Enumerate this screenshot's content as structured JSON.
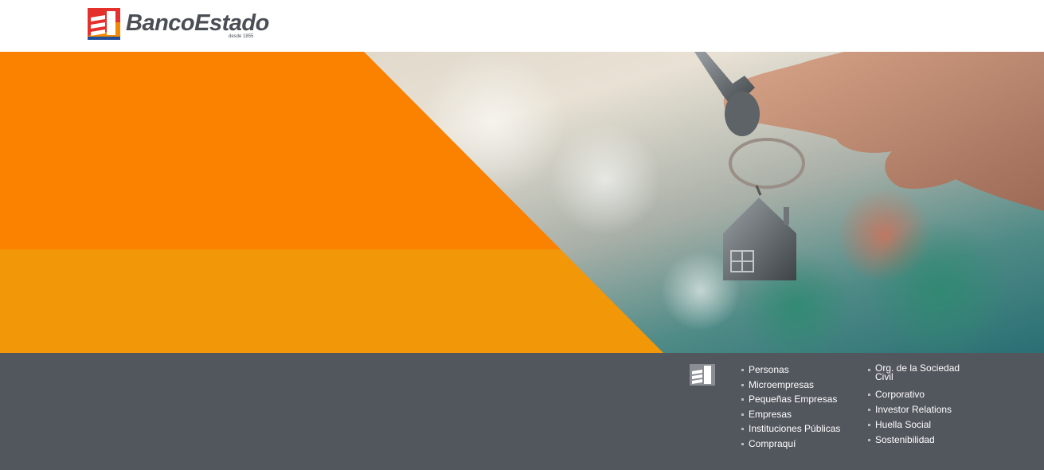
{
  "header": {
    "logo_text": "BancoEstado",
    "logo_tagline": "desde 1855"
  },
  "colors": {
    "orange_primary": "#fb8101",
    "orange_secondary": "#f29707",
    "footer_bg": "#52565d",
    "logo_red": "#e4312b",
    "logo_orange": "#f18a00",
    "logo_text": "#4a4f56"
  },
  "hero": {
    "image_alt": "hand-holding-house-key"
  },
  "footer": {
    "column_a": [
      {
        "label": "Personas"
      },
      {
        "label": "Microempresas"
      },
      {
        "label": "Pequeñas Empresas"
      },
      {
        "label": "Empresas"
      },
      {
        "label": "Instituciones Públicas"
      },
      {
        "label": "Compraquí"
      }
    ],
    "column_b": [
      {
        "label": "Org. de la Sociedad Civil"
      },
      {
        "label": "Corporativo"
      },
      {
        "label": "Investor Relations"
      },
      {
        "label": "Huella Social"
      },
      {
        "label": "Sostenibilidad"
      }
    ]
  }
}
